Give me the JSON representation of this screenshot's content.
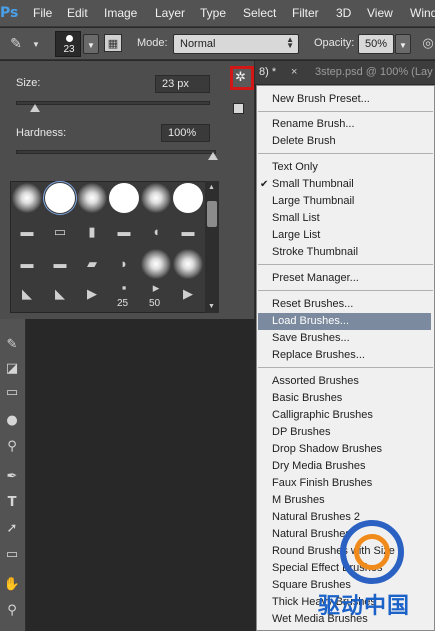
{
  "menubar": {
    "logo": "Ps",
    "items": [
      "File",
      "Edit",
      "Image",
      "Layer",
      "Type",
      "Select",
      "Filter",
      "3D",
      "View",
      "Wind"
    ]
  },
  "options": {
    "brush_size": "23",
    "mode_label": "Mode:",
    "mode_value": "Normal",
    "opacity_label": "Opacity:",
    "opacity_value": "50%"
  },
  "brush_panel": {
    "size_label": "Size:",
    "size_value": "23 px",
    "size_level": 0.1,
    "hardness_label": "Hardness:",
    "hardness_value": "100%",
    "hardness_level": 1.0,
    "thumb_numbers": [
      "25",
      "50"
    ]
  },
  "doc_tabs": {
    "active_label": "8) *",
    "close": "×",
    "inactive_label": "3step.psd @ 100% (Lay"
  },
  "menu": {
    "group1": [
      "New Brush Preset..."
    ],
    "group2": [
      "Rename Brush...",
      "Delete Brush"
    ],
    "group3": [
      "Text Only",
      "Small Thumbnail",
      "Large Thumbnail",
      "Small List",
      "Large List",
      "Stroke Thumbnail"
    ],
    "checked_item": "Small Thumbnail",
    "group4": [
      "Preset Manager..."
    ],
    "group5": [
      "Reset Brushes...",
      "Load Brushes...",
      "Save Brushes...",
      "Replace Brushes..."
    ],
    "highlighted_item": "Load Brushes...",
    "group6": [
      "Assorted Brushes",
      "Basic Brushes",
      "Calligraphic Brushes",
      "DP Brushes",
      "Drop Shadow Brushes",
      "Dry Media Brushes",
      "Faux Finish Brushes",
      "M Brushes",
      "Natural Brushes 2",
      "Natural Brushes",
      "Round Brushes with Size",
      "Special Effect Brushes",
      "Square Brushes",
      "Thick Heavy Brushes",
      "Wet Media Brushes"
    ]
  },
  "watermark": {
    "text": "驱动中国"
  },
  "colors": {
    "accent_highlight": "#7b8a9e",
    "gear_border": "#d31616"
  }
}
